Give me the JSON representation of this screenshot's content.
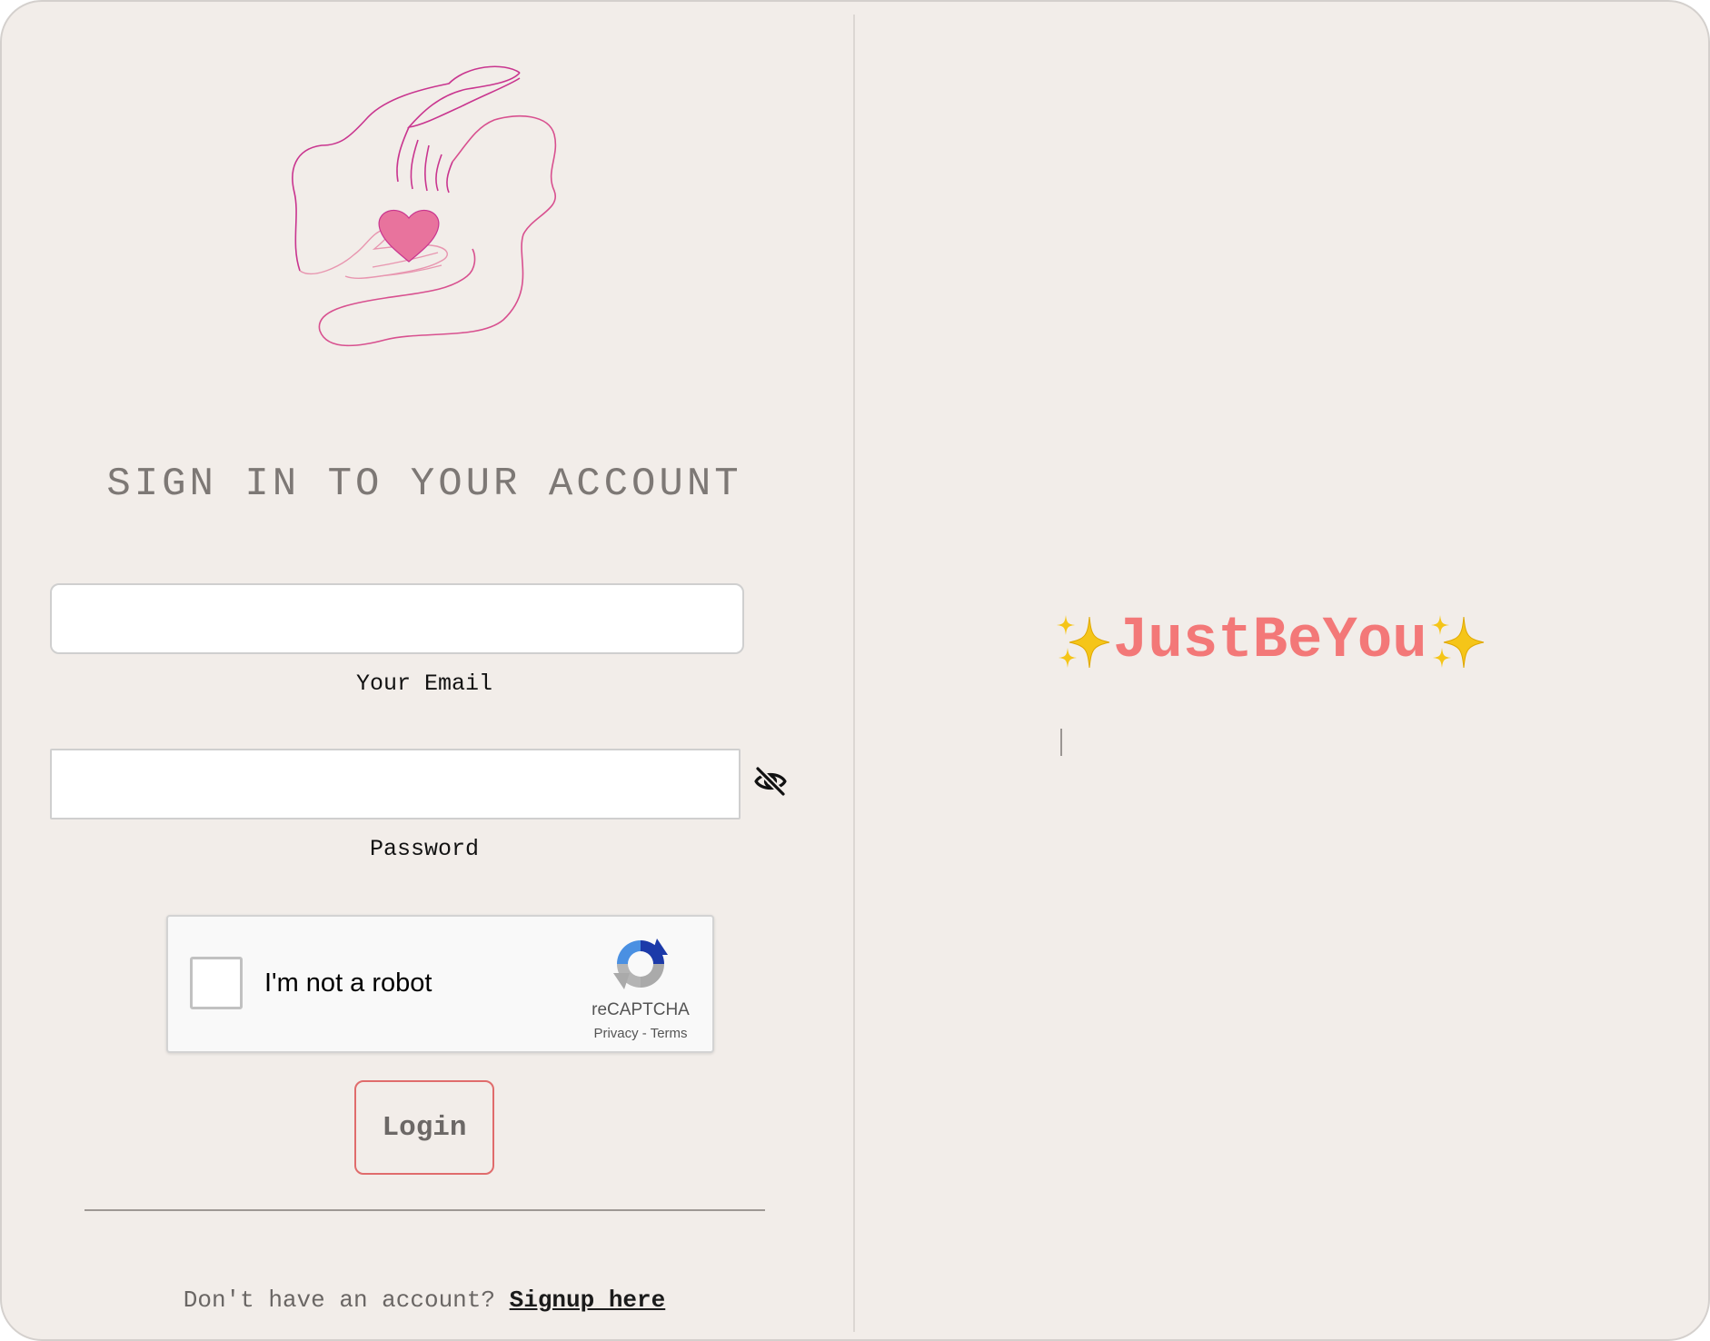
{
  "login_form": {
    "title": "SIGN IN TO YOUR ACCOUNT",
    "email": {
      "label": "Your Email",
      "value": "",
      "placeholder": ""
    },
    "password": {
      "label": "Password",
      "value": "",
      "placeholder": "",
      "toggle_icon": "eye-slash-icon"
    },
    "recaptcha": {
      "label": "I'm not a robot",
      "brand": "reCAPTCHA",
      "privacy": "Privacy",
      "separator": " - ",
      "terms": "Terms"
    },
    "login_button": "Login",
    "signup_prompt": "Don't have an account?",
    "signup_link": "Signup here"
  },
  "brand_panel": {
    "name": "JustBeYou",
    "sparkle_icon": "sparkles-icon"
  },
  "colors": {
    "background": "#f2ede9",
    "brand": "#f37878",
    "login_border": "#e06c6c",
    "logo": "#c9358f",
    "title_text": "#7d7875"
  }
}
